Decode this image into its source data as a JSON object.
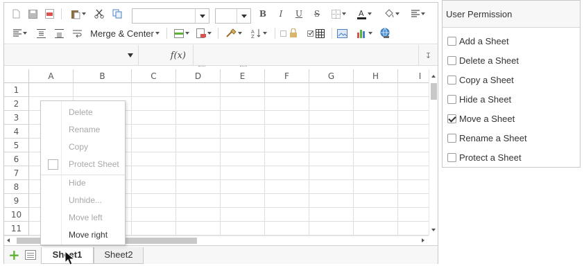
{
  "toolbar": {
    "merge_center_label": "Merge & Center",
    "font_name_value": "",
    "font_size_value": ""
  },
  "formula_bar": {
    "name_box_value": "",
    "fx_label": "f(x)",
    "formula_value": ""
  },
  "grid": {
    "columns": [
      "A",
      "B",
      "C",
      "D",
      "E",
      "F",
      "G",
      "H",
      "I"
    ],
    "rows": [
      "1",
      "2",
      "3",
      "4",
      "5",
      "6",
      "7",
      "8",
      "9",
      "10",
      "11"
    ]
  },
  "context_menu": {
    "items": [
      {
        "label": "Delete",
        "enabled": false
      },
      {
        "label": "Rename",
        "enabled": false
      },
      {
        "label": "Copy",
        "enabled": false
      },
      {
        "label": "Protect Sheet",
        "enabled": false,
        "checkbox": true
      },
      {
        "label": "Hide",
        "enabled": false
      },
      {
        "label": "Unhide...",
        "enabled": false
      },
      {
        "label": "Move left",
        "enabled": false
      },
      {
        "label": "Move right",
        "enabled": true
      }
    ]
  },
  "sheet_tabs": [
    {
      "label": "Sheet1",
      "active": true
    },
    {
      "label": "Sheet2",
      "active": false
    }
  ],
  "permission_panel": {
    "title": "User Permission",
    "options": [
      {
        "label": "Add a Sheet",
        "checked": false
      },
      {
        "label": "Delete a Sheet",
        "checked": false
      },
      {
        "label": "Copy a Sheet",
        "checked": false
      },
      {
        "label": "Hide a Sheet",
        "checked": false
      },
      {
        "label": "Move a Sheet",
        "checked": true
      },
      {
        "label": "Rename a Sheet",
        "checked": false
      },
      {
        "label": "Protect a Sheet",
        "checked": false
      }
    ]
  },
  "colors": {
    "accent_green": "#5cb335",
    "border": "#c8c8c8",
    "disabled_text": "#a8a8a8"
  }
}
